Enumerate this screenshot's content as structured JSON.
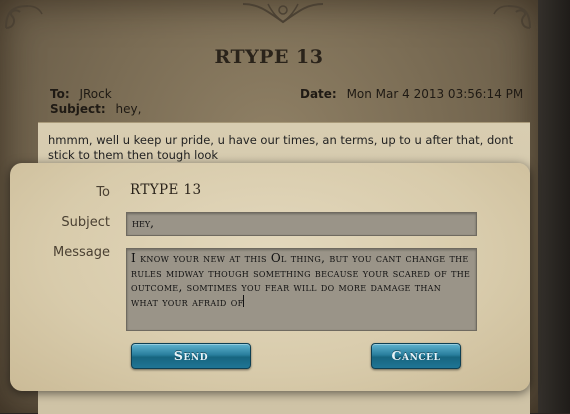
{
  "letter": {
    "title": "RTYPE 13",
    "to_label": "To:",
    "to_value": "JRock",
    "subject_label": "Subject:",
    "subject_value": "hey,",
    "date_label": "Date:",
    "date_value": "Mon Mar 4 2013 03:56:14 PM",
    "body": "hmmm, well u keep ur pride, u have our times, an terms, up to u after that, dont stick to them then tough look"
  },
  "compose": {
    "to_label": "To",
    "to_value": "RTYPE 13",
    "subject_label": "Subject",
    "subject_value": "hey,",
    "message_label": "Message",
    "message_value": "I know your new at this Ol thing, but you cant change the rules midway though something because your scared of the outcome, somtimes you fear will do more damage than what your afraid of",
    "send_label": "Send",
    "cancel_label": "Cancel"
  },
  "colors": {
    "parchment": "#7a6c54",
    "modal": "#d8cbab",
    "button": "#2a7f9e"
  }
}
